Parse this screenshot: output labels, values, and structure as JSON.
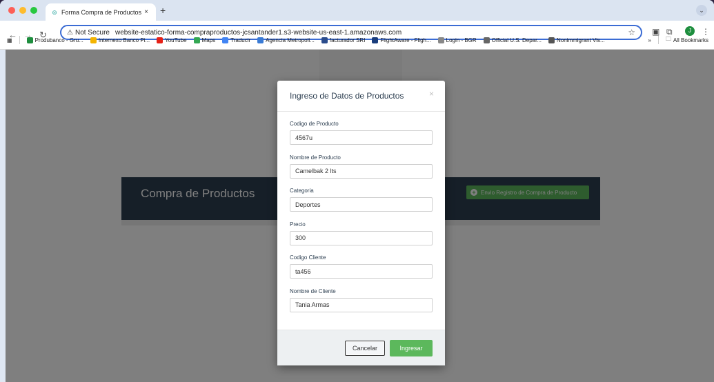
{
  "browser": {
    "tab_title": "Forma Compra de Productos",
    "tab_close": "×",
    "new_tab": "+",
    "not_secure": "Not Secure",
    "url": "website-estatico-forma-compraproductos-jcsantander1.s3-website-us-east-1.amazonaws.com",
    "profile_initial": "J",
    "bookmarks": [
      {
        "label": "Produbanco - Gru...",
        "icon": "star-icon",
        "color": "#1e8e3e"
      },
      {
        "label": "Internexo Banco Pi...",
        "icon": "bank-icon",
        "color": "#f4b400"
      },
      {
        "label": "YouTube",
        "icon": "youtube-icon",
        "color": "#e62117"
      },
      {
        "label": "Maps",
        "icon": "maps-icon",
        "color": "#34a853"
      },
      {
        "label": "Traducir",
        "icon": "translate-icon",
        "color": "#4285f4"
      },
      {
        "label": "Agencia Metropoli...",
        "icon": "agency-icon",
        "color": "#3a7bd5"
      },
      {
        "label": "facturador SRI",
        "icon": "sri-icon",
        "color": "#2b4c8c"
      },
      {
        "label": "FlightAware - Fligh...",
        "icon": "flight-icon",
        "color": "#1a3d7c"
      },
      {
        "label": "Login - BGR",
        "icon": "bgr-icon",
        "color": "#888888"
      },
      {
        "label": "Official U.S. Depar...",
        "icon": "link-icon",
        "color": "#666666"
      },
      {
        "label": "Nonimmigrant Vis...",
        "icon": "globe-icon",
        "color": "#555555"
      }
    ],
    "bookmarks_overflow": "»",
    "all_bookmarks": "All Bookmarks"
  },
  "page": {
    "panel_title": "Compra de Productos",
    "panel_button": "Envio Registro de Compra de Producto"
  },
  "modal": {
    "title": "Ingreso de Datos de Productos",
    "close": "×",
    "fields": [
      {
        "label": "Codigo de Producto",
        "value": "4567u"
      },
      {
        "label": "Nombre de Producto",
        "value": "Camelbak 2 lts"
      },
      {
        "label": "Categoria",
        "value": "Deportes"
      },
      {
        "label": "Precio",
        "value": "300"
      },
      {
        "label": "Codigo Cliente",
        "value": "ta456"
      },
      {
        "label": "Nombre de Cliente",
        "value": "Tania Armas"
      }
    ],
    "cancel_label": "Cancelar",
    "submit_label": "Ingresar"
  },
  "colors": {
    "panel": "#2c3e50",
    "success": "#5cb85c",
    "omnibox_border": "#3b6cd4"
  }
}
